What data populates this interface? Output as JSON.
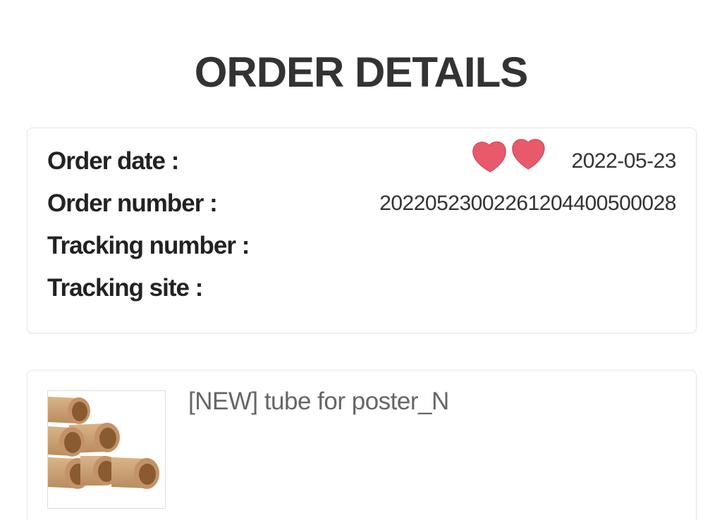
{
  "page": {
    "title": "ORDER DETAILS"
  },
  "order": {
    "date_label": "Order date :",
    "date_value": "2022-05-23",
    "number_label": "Order number :",
    "number_value": "20220523002261204400500028",
    "tracking_number_label": "Tracking number :",
    "tracking_number_value": "",
    "tracking_site_label": "Tracking site :",
    "tracking_site_value": ""
  },
  "decoration": {
    "icon": "heart-sticker-icon",
    "color": "#e8596b"
  },
  "product": {
    "name": "[NEW] tube for poster_N",
    "image_icon": "cardboard-tubes-image"
  }
}
